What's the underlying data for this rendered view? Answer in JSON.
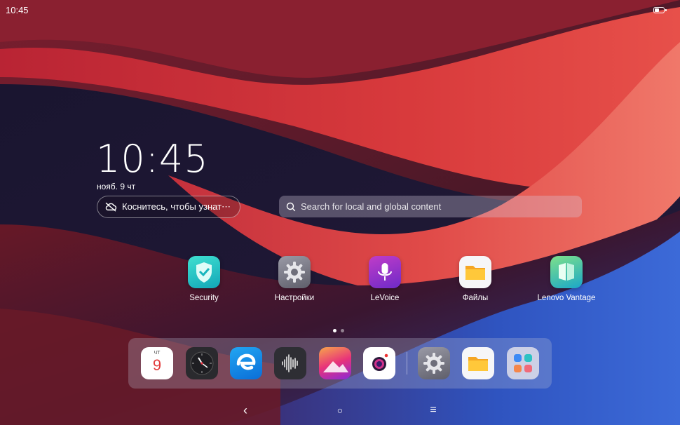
{
  "status": {
    "time": "10:45",
    "battery_level": 0.55
  },
  "lockclock": {
    "time": "10:45",
    "date": "нояб. 9 чт"
  },
  "weather": {
    "label": "Коснитесь, чтобы узнат⋯",
    "icon": "cloud-off-icon"
  },
  "search": {
    "placeholder": "Search for local and global content",
    "icon": "search-icon"
  },
  "apps": [
    {
      "label": "Security",
      "icon": "security-shield-icon"
    },
    {
      "label": "Настройки",
      "icon": "settings-gear-icon"
    },
    {
      "label": "LeVoice",
      "icon": "microphone-icon"
    },
    {
      "label": "Файлы",
      "icon": "files-folder-icon"
    },
    {
      "label": "Lenovo Vantage",
      "icon": "lenovo-vantage-icon"
    }
  ],
  "pages": {
    "count": 2,
    "current": 1
  },
  "dock": {
    "calendar": {
      "weekday": "ЧТ",
      "day": "9"
    },
    "items": [
      "calendar-icon",
      "clock-icon",
      "browser-icon",
      "voice-recorder-icon",
      "gallery-icon",
      "camera-icon",
      "settings-gear-icon",
      "files-folder-icon",
      "app-drawer-icon"
    ]
  },
  "nav": {
    "back": "‹",
    "home": "○",
    "menu": "≡"
  },
  "colors": {
    "accent_red": "#d23a3a",
    "wall_dark": "#1b1530",
    "wall_blue": "#2d55b8"
  }
}
